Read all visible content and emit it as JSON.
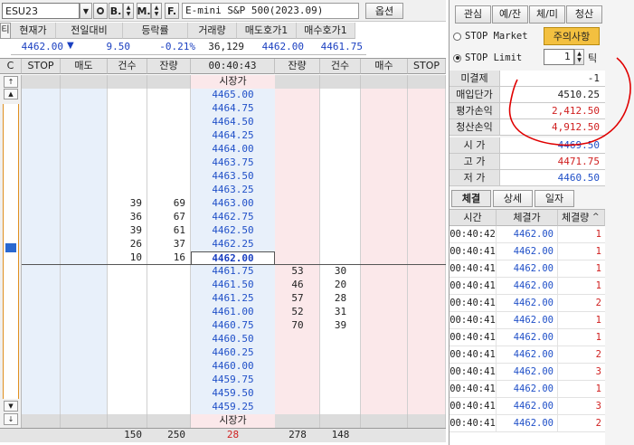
{
  "toolbar": {
    "symbol": "ESU23",
    "btn_q": "Q",
    "btn_b": "B.",
    "btn_m": "M.",
    "btn_f": "F.",
    "product_name": "E-mini S&P 500(2023.09)",
    "options_label": "옵션"
  },
  "quote": {
    "headers": [
      "현재가",
      "전일대비",
      "등락률",
      "거래량",
      "매도호가1",
      "매수호가1"
    ],
    "left_mark": "티",
    "current_price": "4462.00",
    "change_arrow": "▼",
    "change": "9.50",
    "change_rate": "-0.21%",
    "volume": "36,129",
    "ask1": "4462.00",
    "bid1": "4461.75"
  },
  "orderbook": {
    "headers": [
      "C",
      "STOP",
      "매도",
      "건수",
      "잔량",
      "00:40:43",
      "잔량",
      "건수",
      "매수",
      "STOP"
    ],
    "open_label_top": "시장가",
    "open_label_bottom": "시장가",
    "prices": [
      "4465.00",
      "4464.75",
      "4464.50",
      "4464.25",
      "4464.00",
      "4463.75",
      "4463.50",
      "4463.25",
      "4463.00",
      "4462.75",
      "4462.50",
      "4462.25",
      "4462.00",
      "4461.75",
      "4461.50",
      "4461.25",
      "4461.00",
      "4460.75",
      "4460.50",
      "4460.25",
      "4460.00",
      "4459.75",
      "4459.50",
      "4459.25"
    ],
    "ask_rows": [
      {
        "row": 8,
        "count": "39",
        "qty": "69"
      },
      {
        "row": 9,
        "count": "36",
        "qty": "67"
      },
      {
        "row": 10,
        "count": "39",
        "qty": "61"
      },
      {
        "row": 11,
        "count": "26",
        "qty": "37"
      },
      {
        "row": 12,
        "count": "10",
        "qty": "16"
      }
    ],
    "bid_rows": [
      {
        "row": 13,
        "qty": "53",
        "count": "30"
      },
      {
        "row": 14,
        "qty": "46",
        "count": "20"
      },
      {
        "row": 15,
        "qty": "57",
        "count": "28"
      },
      {
        "row": 16,
        "qty": "52",
        "count": "31"
      },
      {
        "row": 17,
        "qty": "70",
        "count": "39"
      }
    ],
    "totals": {
      "ask_count": "150",
      "ask_qty": "250",
      "diff": "28",
      "bid_qty": "278",
      "bid_count": "148"
    }
  },
  "right_panel": {
    "top_buttons": [
      "관심",
      "예/잔",
      "체/미",
      "청산"
    ],
    "stop_market_label": "STOP Market",
    "stop_limit_label": "STOP Limit",
    "caution_label": "주의사항",
    "tick_value": "1",
    "tick_unit": "틱",
    "position": [
      {
        "label": "미결제",
        "value": "-1",
        "color": "#222222"
      },
      {
        "label": "매입단가",
        "value": "4510.25",
        "color": "#222222"
      },
      {
        "label": "평가손익",
        "value": "2,412.50",
        "color": "#d02020"
      },
      {
        "label": "청산손익",
        "value": "4,912.50",
        "color": "#d02020"
      }
    ],
    "ohl": [
      {
        "label": "시 가",
        "value": "4469.50",
        "color": "#2050c8"
      },
      {
        "label": "고 가",
        "value": "4471.75",
        "color": "#d02020"
      },
      {
        "label": "저 가",
        "value": "4460.50",
        "color": "#2050c8"
      }
    ],
    "tabs": [
      "체결",
      "상세",
      "일자"
    ],
    "trade_headers": [
      "시간",
      "체결가",
      "체결량"
    ],
    "trades": [
      {
        "time": "00:40:42",
        "price": "4462.00",
        "qty": "1"
      },
      {
        "time": "00:40:41",
        "price": "4462.00",
        "qty": "1"
      },
      {
        "time": "00:40:41",
        "price": "4462.00",
        "qty": "1"
      },
      {
        "time": "00:40:41",
        "price": "4462.00",
        "qty": "1"
      },
      {
        "time": "00:40:41",
        "price": "4462.00",
        "qty": "2"
      },
      {
        "time": "00:40:41",
        "price": "4462.00",
        "qty": "1"
      },
      {
        "time": "00:40:41",
        "price": "4462.00",
        "qty": "1"
      },
      {
        "time": "00:40:41",
        "price": "4462.00",
        "qty": "2"
      },
      {
        "time": "00:40:41",
        "price": "4462.00",
        "qty": "3"
      },
      {
        "time": "00:40:41",
        "price": "4462.00",
        "qty": "1"
      },
      {
        "time": "00:40:41",
        "price": "4462.00",
        "qty": "3"
      },
      {
        "time": "00:40:41",
        "price": "4462.00",
        "qty": "2"
      },
      {
        "time": "00:40:41",
        "price": "4462.00",
        "qty": "1"
      },
      {
        "time": "00:40:41",
        "price": "4462.00",
        "qty": "1"
      },
      {
        "time": "00:40:41",
        "price": "4462.00",
        "qty": "2"
      }
    ]
  },
  "colors": {
    "ask_bg": "#e8f0fa",
    "bid_bg": "#fbe8ea",
    "ask_price": "#2050c8",
    "bid_price": "#2050c8",
    "current_price": "#1a3fc0",
    "up": "#d02020",
    "annotation": "#e00000"
  }
}
